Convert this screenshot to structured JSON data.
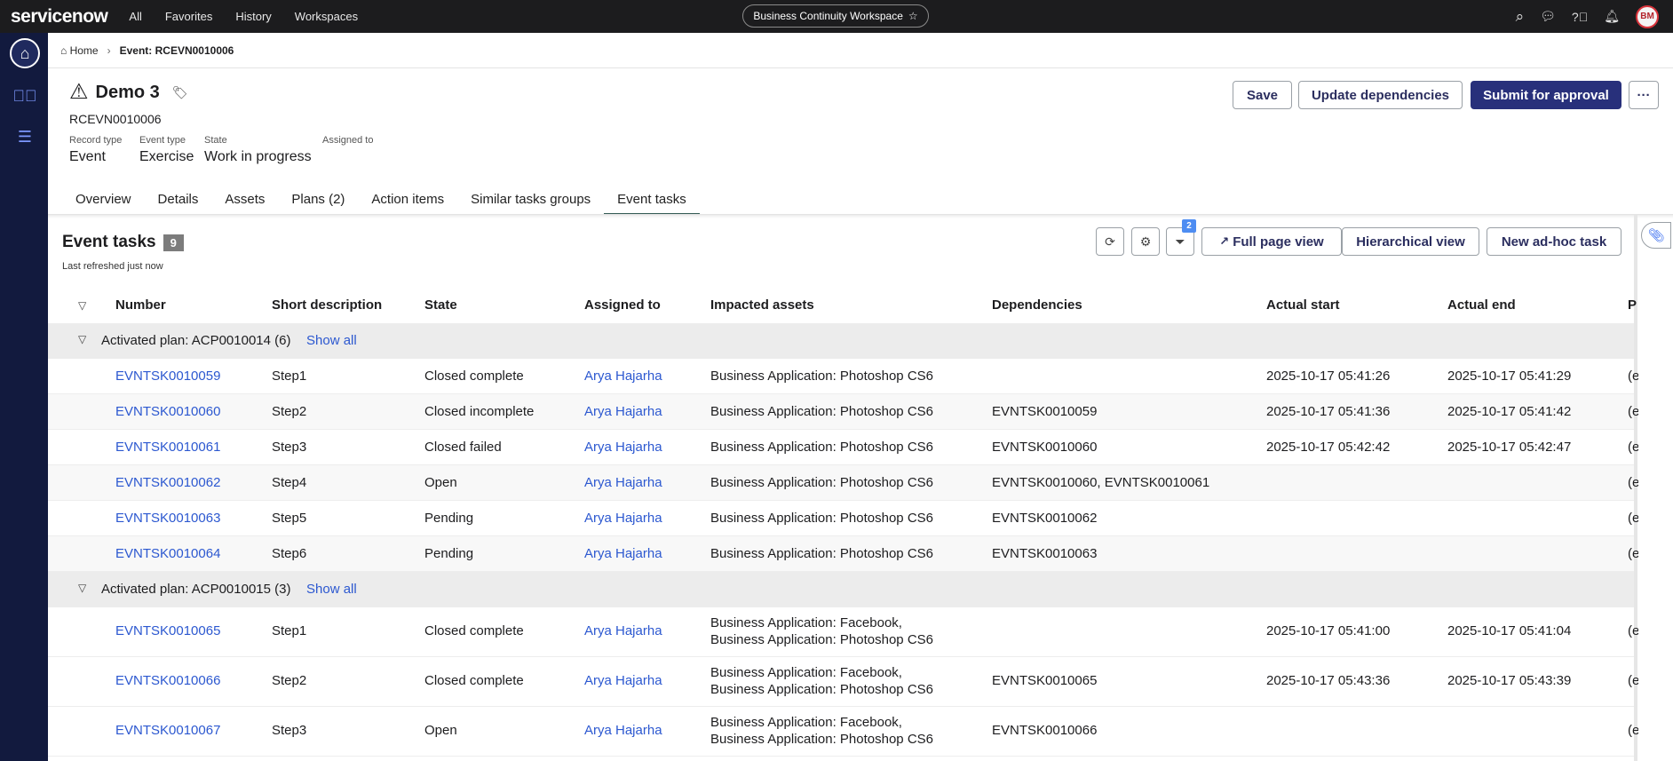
{
  "topbar": {
    "logo": "servicenow",
    "nav": [
      "All",
      "Favorites",
      "History",
      "Workspaces"
    ],
    "workspace": "Business Continuity Workspace",
    "avatar_initials": "BM"
  },
  "breadcrumb": {
    "home": "Home",
    "current": "Event: RCEVN0010006"
  },
  "record": {
    "title": "Demo 3",
    "number": "RCEVN0010006",
    "fields": [
      {
        "label": "Record type",
        "value": "Event"
      },
      {
        "label": "Event type",
        "value": "Exercise"
      },
      {
        "label": "State",
        "value": "Work in progress"
      },
      {
        "label": "Assigned to",
        "value": ""
      }
    ],
    "actions": {
      "save": "Save",
      "update_deps": "Update dependencies",
      "submit": "Submit for approval",
      "more": "···"
    }
  },
  "tabs": [
    "Overview",
    "Details",
    "Assets",
    "Plans (2)",
    "Action items",
    "Similar tasks groups",
    "Event tasks"
  ],
  "active_tab": "Event tasks",
  "panel": {
    "title": "Event tasks",
    "count": "9",
    "refreshed": "Last refreshed just now",
    "filter_badge": "2",
    "full_page": "Full page view",
    "hierarchical": "Hierarchical view",
    "new_task": "New ad-hoc task"
  },
  "table": {
    "columns": [
      "Number",
      "Short description",
      "State",
      "Assigned to",
      "Impacted assets",
      "Dependencies",
      "Actual start",
      "Actual end",
      "P"
    ],
    "groups": [
      {
        "label": "Activated plan: ACP0010014 (6)",
        "show_all": "Show all",
        "rows": [
          {
            "number": "EVNTSK0010059",
            "desc": "Step1",
            "state": "Closed complete",
            "assigned": "Arya Hajarha",
            "assets": [
              "Business Application: Photoshop CS6"
            ],
            "deps": "",
            "start": "2025-10-17 05:41:26",
            "end": "2025-10-17 05:41:29",
            "p": "(e"
          },
          {
            "number": "EVNTSK0010060",
            "desc": "Step2",
            "state": "Closed incomplete",
            "assigned": "Arya Hajarha",
            "assets": [
              "Business Application: Photoshop CS6"
            ],
            "deps": "EVNTSK0010059",
            "start": "2025-10-17 05:41:36",
            "end": "2025-10-17 05:41:42",
            "p": "(e"
          },
          {
            "number": "EVNTSK0010061",
            "desc": "Step3",
            "state": "Closed failed",
            "assigned": "Arya Hajarha",
            "assets": [
              "Business Application: Photoshop CS6"
            ],
            "deps": "EVNTSK0010060",
            "start": "2025-10-17 05:42:42",
            "end": "2025-10-17 05:42:47",
            "p": "(e"
          },
          {
            "number": "EVNTSK0010062",
            "desc": "Step4",
            "state": "Open",
            "assigned": "Arya Hajarha",
            "assets": [
              "Business Application: Photoshop CS6"
            ],
            "deps": "EVNTSK0010060, EVNTSK0010061",
            "start": "",
            "end": "",
            "p": "(e"
          },
          {
            "number": "EVNTSK0010063",
            "desc": "Step5",
            "state": "Pending",
            "assigned": "Arya Hajarha",
            "assets": [
              "Business Application: Photoshop CS6"
            ],
            "deps": "EVNTSK0010062",
            "start": "",
            "end": "",
            "p": "(e"
          },
          {
            "number": "EVNTSK0010064",
            "desc": "Step6",
            "state": "Pending",
            "assigned": "Arya Hajarha",
            "assets": [
              "Business Application: Photoshop CS6"
            ],
            "deps": "EVNTSK0010063",
            "start": "",
            "end": "",
            "p": "(e"
          }
        ]
      },
      {
        "label": "Activated plan: ACP0010015 (3)",
        "show_all": "Show all",
        "rows": [
          {
            "number": "EVNTSK0010065",
            "desc": "Step1",
            "state": "Closed complete",
            "assigned": "Arya Hajarha",
            "assets": [
              "Business Application: Facebook,",
              "Business Application: Photoshop CS6"
            ],
            "deps": "",
            "start": "2025-10-17 05:41:00",
            "end": "2025-10-17 05:41:04",
            "p": "(e"
          },
          {
            "number": "EVNTSK0010066",
            "desc": "Step2",
            "state": "Closed complete",
            "assigned": "Arya Hajarha",
            "assets": [
              "Business Application: Facebook,",
              "Business Application: Photoshop CS6"
            ],
            "deps": "EVNTSK0010065",
            "start": "2025-10-17 05:43:36",
            "end": "2025-10-17 05:43:39",
            "p": "(e"
          },
          {
            "number": "EVNTSK0010067",
            "desc": "Step3",
            "state": "Open",
            "assigned": "Arya Hajarha",
            "assets": [
              "Business Application: Facebook,",
              "Business Application: Photoshop CS6"
            ],
            "deps": "EVNTSK0010066",
            "start": "",
            "end": "",
            "p": "(e"
          }
        ]
      }
    ]
  }
}
